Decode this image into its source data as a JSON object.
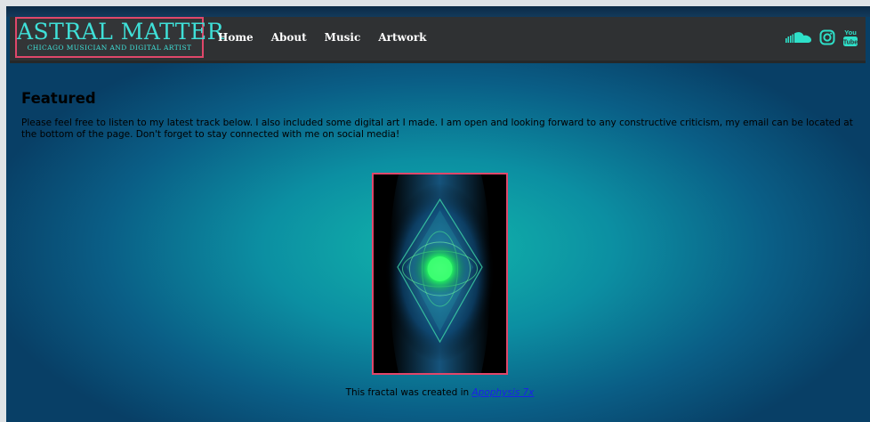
{
  "brand": {
    "title": "ASTRAL MATTER",
    "subtitle": "CHICAGO MUSICIAN AND DIGITAL ARTIST"
  },
  "nav": {
    "items": [
      {
        "label": "Home"
      },
      {
        "label": "About"
      },
      {
        "label": "Music"
      },
      {
        "label": "Artwork"
      }
    ]
  },
  "social": {
    "icons": [
      "soundcloud-icon",
      "instagram-icon",
      "youtube-icon"
    ],
    "youtube_top": "You",
    "youtube_bottom": "Tube",
    "accent_color": "#2ee0c9"
  },
  "featured": {
    "title": "Featured",
    "intro": "Please feel free to listen to my latest track below. I also included some digital art I made. I am open and looking forward to any constructive criticism, my email can be located at the bottom of the page. Don't forget to stay connected with me on social media!"
  },
  "artwork": {
    "caption_prefix": "This fractal was created in ",
    "caption_link": "Apophysis 7x"
  },
  "colors": {
    "brand_text": "#3fe0d8",
    "logo_border": "#e0476a",
    "navbar_bg": "#2f3133",
    "link": "#1a23e6"
  }
}
